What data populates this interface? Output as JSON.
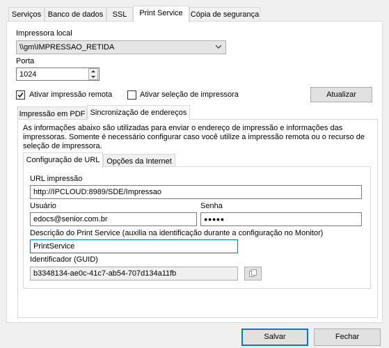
{
  "tabs": [
    {
      "label": "Serviços",
      "active": false
    },
    {
      "label": "Banco de dados",
      "active": false
    },
    {
      "label": "SSL",
      "active": false
    },
    {
      "label": "Print Service",
      "active": true
    },
    {
      "label": "Cópia de segurança",
      "active": false
    }
  ],
  "printer": {
    "label": "Impressora local",
    "value": "\\\\gm\\IMPRESSAO_RETIDA"
  },
  "port": {
    "label": "Porta",
    "value": "1024"
  },
  "options": {
    "remote_print": {
      "label": "Ativar impressão remota",
      "checked": true
    },
    "printer_selection": {
      "label": "Ativar seleção de impressora",
      "checked": false
    },
    "update_button": "Atualizar"
  },
  "subtabs": [
    {
      "label": "Impressão em PDF",
      "active": false
    },
    {
      "label": "Sincronização de endereços",
      "active": true
    }
  ],
  "sync": {
    "description": "As informações abaixo são utilizadas para enviar o endereço de impressão e informações das impressoras. Somente é necessário configurar caso você utilize a impressão remota ou o recurso de seleção de impressora.",
    "tabs": [
      {
        "label": "Configuração de URL",
        "active": true
      },
      {
        "label": "Opções da Internet",
        "active": false
      }
    ],
    "url": {
      "label": "URL impressão",
      "value": "http://IPCLOUD:8989/SDE/Impressao"
    },
    "user": {
      "label": "Usuário",
      "value": "edocs@senior.com.br"
    },
    "password": {
      "label": "Senha",
      "value": "●●●●●"
    },
    "service_description": {
      "label": "Descrição do Print Service (auxilia na identificação durante a configuração no Monitor)",
      "value": "PrintService"
    },
    "guid": {
      "label": "Identificador (GUID)",
      "value": "b3348134-ae0c-41c7-ab54-707d134a11fb"
    }
  },
  "footer": {
    "save": "Salvar",
    "close": "Fechar"
  },
  "colors": {
    "accent": "#0078d7",
    "window_bg": "#f0f0f0",
    "button_bg": "#e1e1e1"
  }
}
